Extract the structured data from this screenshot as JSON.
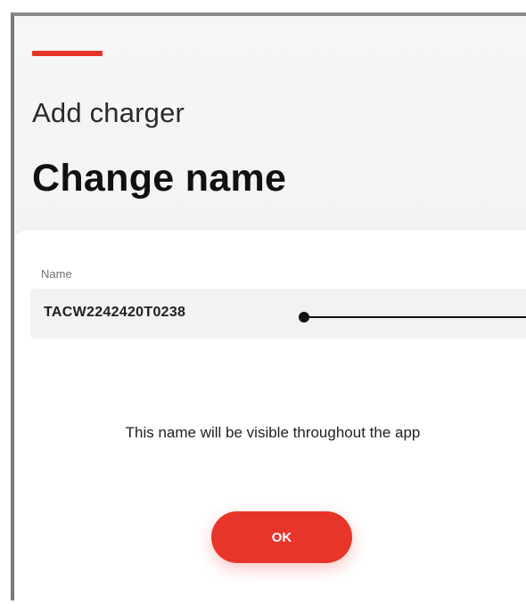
{
  "header": {
    "subtitle": "Add charger",
    "title": "Change name",
    "accent_color": "#e8352a"
  },
  "form": {
    "name_label": "Name",
    "name_value": "TACW2242420T0238",
    "hint": "This name will be visible throughout the app",
    "ok_label": "OK"
  }
}
